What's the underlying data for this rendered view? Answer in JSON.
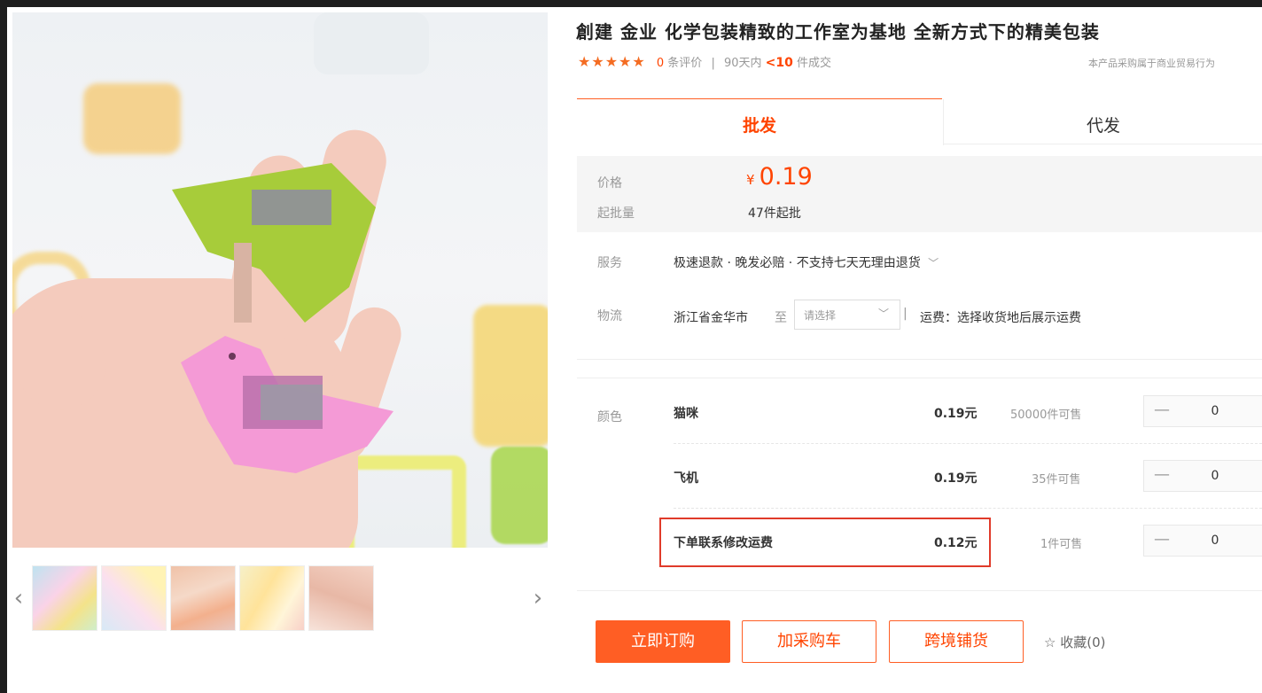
{
  "product": {
    "title": "創建 金业 化学包装精致的工作室为基地 全新方式下的精美包装",
    "rating_count": "0",
    "rating_suffix": "条评价",
    "sold_prefix": "90天内",
    "sold_count": "<10",
    "sold_suffix": "件成交",
    "notice": "本产品采购属于商业贸易行为"
  },
  "tabs": {
    "wholesale": "批发",
    "dropship": "代发"
  },
  "price": {
    "label": "价格",
    "currency": "¥",
    "amount": "0.19",
    "moq_label": "起批量",
    "moq_value": "47件起批"
  },
  "service": {
    "label": "服务",
    "text": "极速退款 · 晚发必赔 · 不支持七天无理由退货",
    "chevron_icon": "chevron-down-icon"
  },
  "logistics": {
    "label": "物流",
    "origin": "浙江省金华市",
    "to": "至",
    "select_placeholder": "请选择",
    "freight": "运费：选择收货地后展示运费"
  },
  "color": {
    "label": "颜色",
    "options": [
      {
        "name": "猫咪",
        "price": "0.19元",
        "stock": "50000件可售",
        "minus": "—",
        "qty": "0"
      },
      {
        "name": "飞机",
        "price": "0.19元",
        "stock": "35件可售",
        "minus": "—",
        "qty": "0"
      },
      {
        "name": "下单联系修改运费",
        "price": "0.12元",
        "stock": "1件可售",
        "minus": "—",
        "qty": "0"
      }
    ]
  },
  "actions": {
    "buy_now": "立即订购",
    "add_cart": "加采购车",
    "cross_border": "跨境铺货",
    "favorite": "收藏(0)"
  },
  "gallery": {
    "prev_icon": "chevron-left-icon",
    "next_icon": "chevron-right-icon",
    "thumb_count": 5
  },
  "colors": {
    "accent": "#ff5e24",
    "price_orange": "#ff4400",
    "highlight_box": "#e03b2a",
    "star": "#f46c22"
  }
}
